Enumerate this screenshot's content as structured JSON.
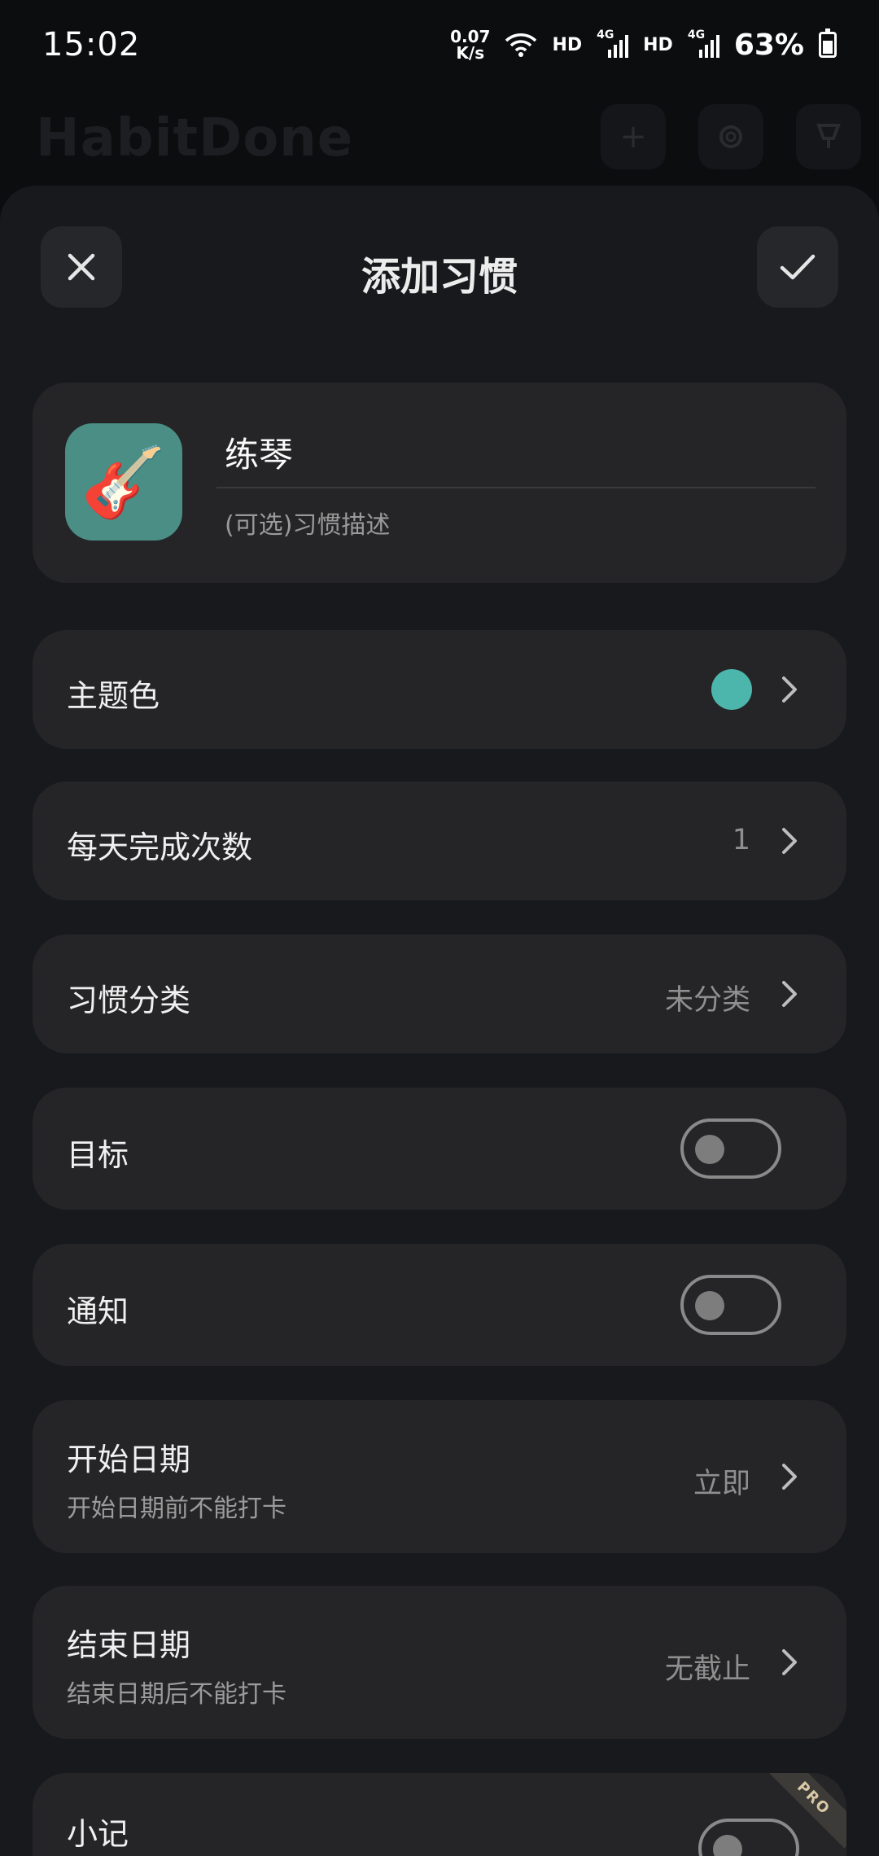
{
  "status_bar": {
    "time": "15:02",
    "net_speed_value": "0.07",
    "net_speed_unit": "K/s",
    "hd1": "HD",
    "sim1_tag": "4G",
    "hd2": "HD",
    "sim2_tag": "4G",
    "battery_percent": "63%"
  },
  "background_app": {
    "title": "HabitDone"
  },
  "sheet": {
    "title": "添加习惯",
    "habit": {
      "icon": "guitar-emoji",
      "icon_glyph": "🎸",
      "name_value": "练琴",
      "description_placeholder": "(可选)习惯描述"
    },
    "rows": {
      "theme_color": {
        "label": "主题色",
        "color": "#4db6ac"
      },
      "daily_count": {
        "label": "每天完成次数",
        "value": "1"
      },
      "category": {
        "label": "习惯分类",
        "value": "未分类"
      },
      "goal": {
        "label": "目标",
        "enabled": false
      },
      "notification": {
        "label": "通知",
        "enabled": false
      },
      "start_date": {
        "label": "开始日期",
        "sub": "开始日期前不能打卡",
        "value": "立即"
      },
      "end_date": {
        "label": "结束日期",
        "sub": "结束日期后不能打卡",
        "value": "无截止"
      },
      "note": {
        "label": "小记",
        "badge": "PRO",
        "enabled": false
      }
    }
  }
}
